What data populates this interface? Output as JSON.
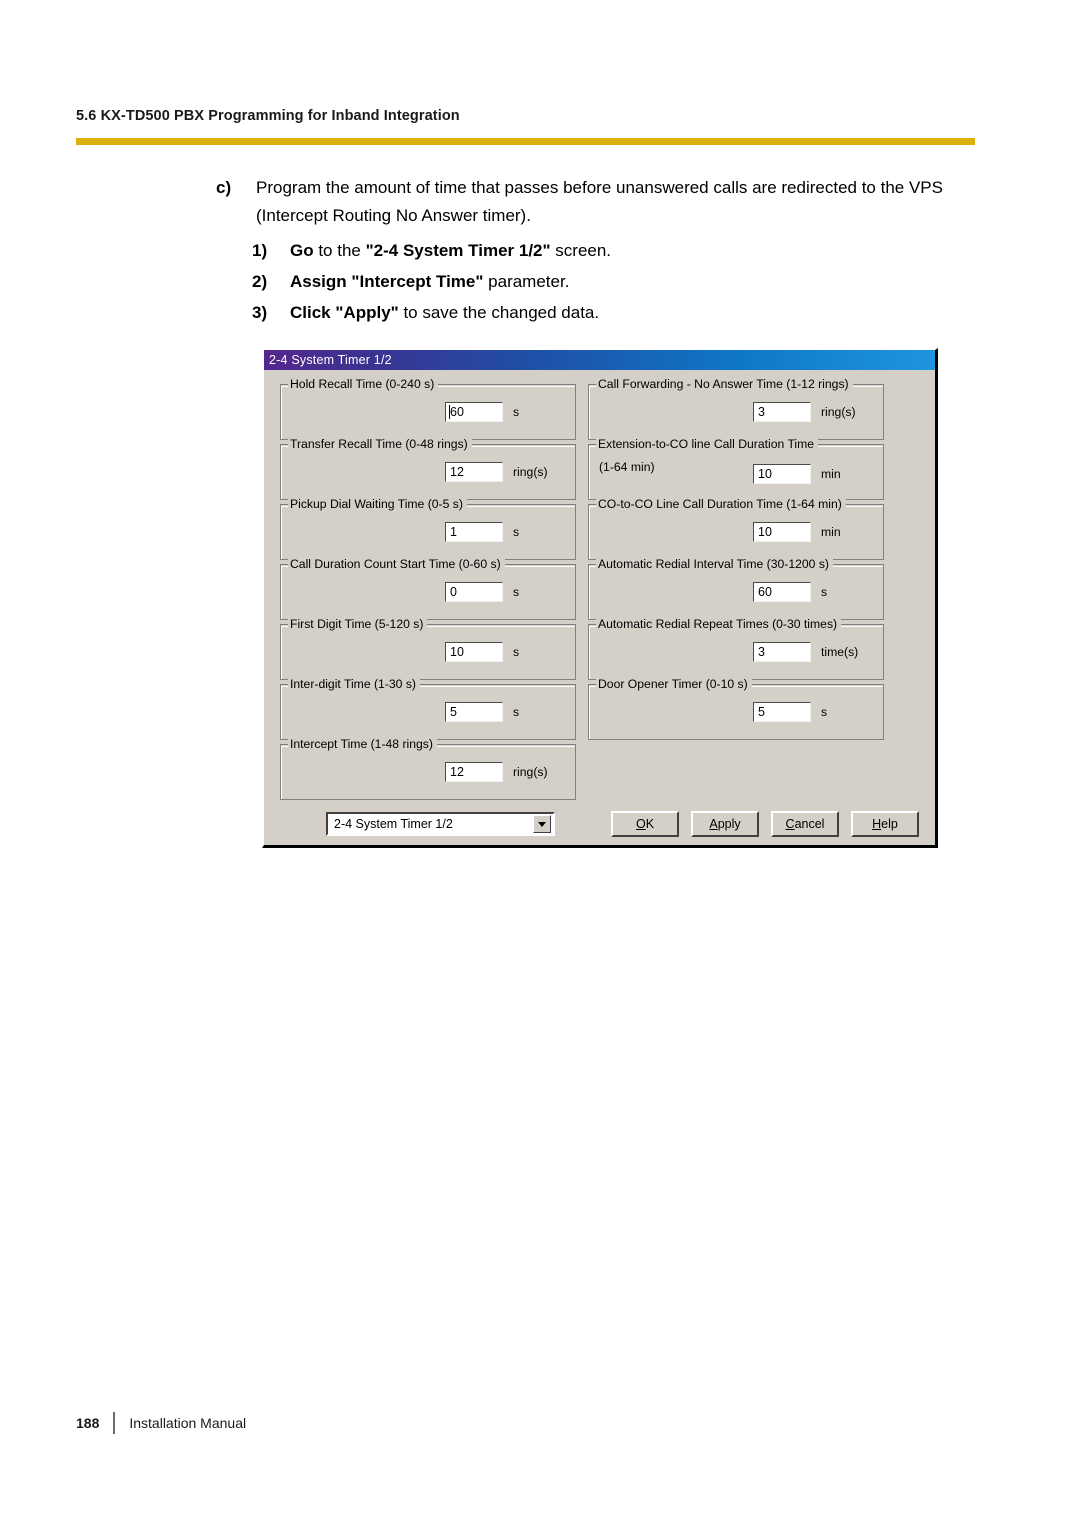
{
  "header": {
    "section_title": "5.6 KX-TD500 PBX Programming for Inband Integration",
    "rule_color": "#d9b00c"
  },
  "instructions": {
    "item_marker": "c)",
    "item_text": "Program the amount of time that passes before unanswered calls are redirected to the VPS (Intercept Routing No Answer timer).",
    "steps": [
      {
        "marker": "1)",
        "bold1": "Go",
        "mid1": " to the ",
        "bold2": "\"2-4 System Timer 1/2\"",
        "tail": " screen."
      },
      {
        "marker": "2)",
        "bold1": "Assign",
        "mid1": " ",
        "bold2": "\"Intercept Time\"",
        "tail": " parameter."
      },
      {
        "marker": "3)",
        "bold1": "Click",
        "mid1": " ",
        "bold2": "\"Apply\"",
        "tail": " to save the changed data."
      }
    ]
  },
  "dialog": {
    "title": "2-4 System Timer 1/2",
    "titlebar_gradient_start": "#54268f",
    "titlebar_gradient_end": "#1f95e0",
    "face_color": "#d4d0c8",
    "left_column": [
      {
        "label": "Hold Recall Time (0-240 s)",
        "value": "60",
        "unit": "s",
        "caret": true
      },
      {
        "label": "Transfer Recall Time (0-48 rings)",
        "value": "12",
        "unit": "ring(s)",
        "caret": false
      },
      {
        "label": "Pickup Dial Waiting Time (0-5 s)",
        "value": "1",
        "unit": "s",
        "caret": false
      },
      {
        "label": "Call Duration Count Start Time (0-60 s)",
        "value": "0",
        "unit": "s",
        "caret": false
      },
      {
        "label": "First Digit Time (5-120 s)",
        "value": "10",
        "unit": "s",
        "caret": false
      },
      {
        "label": "Inter-digit Time (1-30 s)",
        "value": "5",
        "unit": "s",
        "caret": false
      },
      {
        "label": "Intercept Time (1-48 rings)",
        "value": "12",
        "unit": "ring(s)",
        "caret": false
      }
    ],
    "right_column": [
      {
        "label": "Call Forwarding - No Answer Time (1-12 rings)",
        "label2": "",
        "value": "3",
        "unit": "ring(s)"
      },
      {
        "label": "Extension-to-CO line Call Duration Time",
        "label2": "(1-64 min)",
        "value": "10",
        "unit": "min"
      },
      {
        "label": "CO-to-CO Line Call Duration Time (1-64 min)",
        "label2": "",
        "value": "10",
        "unit": "min"
      },
      {
        "label": "Automatic Redial Interval Time (30-1200 s)",
        "label2": "",
        "value": "60",
        "unit": "s"
      },
      {
        "label": "Automatic Redial Repeat Times (0-30 times)",
        "label2": "",
        "value": "3",
        "unit": "time(s)"
      },
      {
        "label": "Door Opener Timer (0-10 s)",
        "label2": "",
        "value": "5",
        "unit": "s"
      }
    ],
    "screen_select": {
      "value": "2-4 System Timer 1/2",
      "icon": "chevron-down-icon"
    },
    "buttons": [
      {
        "accel": "O",
        "rest": "K"
      },
      {
        "accel": "A",
        "rest": "pply"
      },
      {
        "accel": "C",
        "rest": "ancel"
      },
      {
        "accel": "H",
        "rest": "elp"
      }
    ]
  },
  "footer": {
    "page_number": "188",
    "manual_title": "Installation Manual"
  }
}
